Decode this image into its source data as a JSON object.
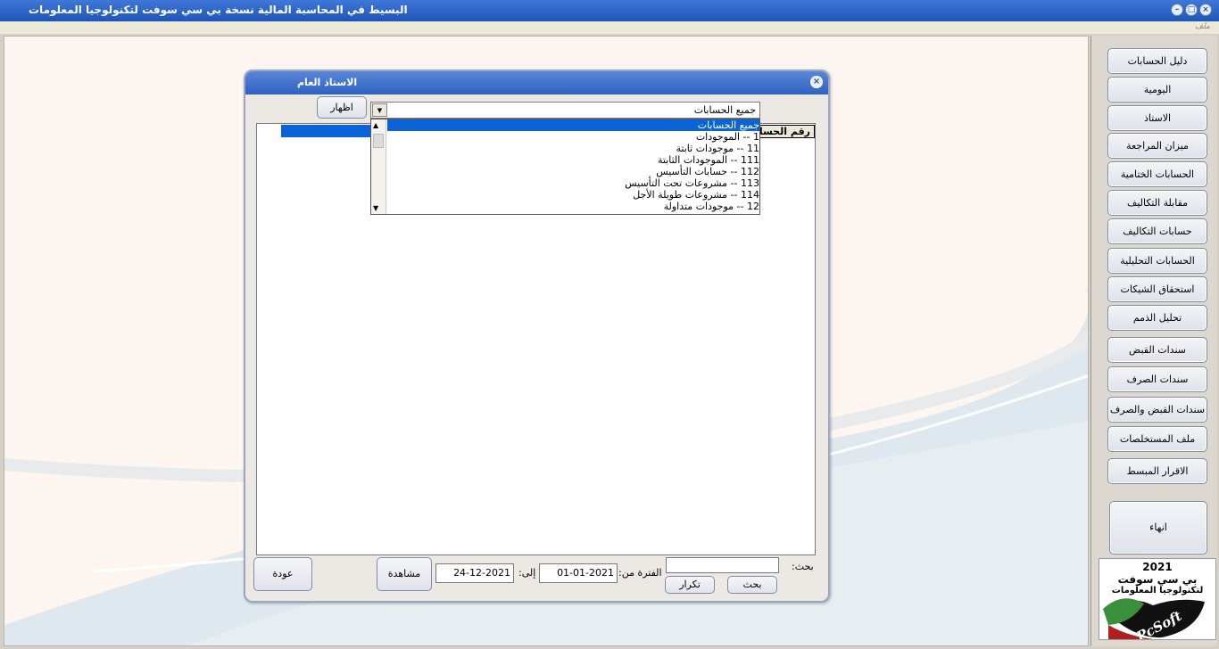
{
  "app": {
    "title": "البسيط في المحاسبة المالية   نسخة بي سي سوفت لتكنولوجيا المعلومات",
    "menu": "ملف",
    "window_buttons": [
      "minimize-icon",
      "restore-icon",
      "close-icon"
    ]
  },
  "sidebar": {
    "items": [
      {
        "label": "دليل الحسابات"
      },
      {
        "label": "اليومية"
      },
      {
        "label": "الاستاذ"
      },
      {
        "label": "ميزان المراجعة"
      },
      {
        "label": "الحسابات الختامية"
      },
      {
        "label": "مقابلة التكاليف"
      },
      {
        "label": "حسابات التكاليف"
      },
      {
        "label": "الحسابات التحليلية"
      },
      {
        "label": "استحقاق الشيكات"
      },
      {
        "label": "تحليل الذمم"
      },
      {
        "label": "سندات القبض"
      },
      {
        "label": "سندات الصرف"
      },
      {
        "label": "سندات القبض والصرف"
      },
      {
        "label": "ملف المستخلصات"
      },
      {
        "label": "الاقرار المبسط"
      }
    ],
    "exit_label": "انهاء"
  },
  "logo": {
    "year": "2021",
    "line1": "بي سي سوفت",
    "line2": "لتكنولوجيا المعلومات",
    "brand": "PcSoft"
  },
  "dialog": {
    "title": "الاستاذ العام",
    "show_button": "اظهار",
    "account_combo": {
      "value": "جميع الحسابات",
      "options": [
        "جميع الحسابات",
        "1 -- الموجودات",
        "11 -- موجودات ثابتة",
        "111 -- الموجودات الثابتة",
        "112 -- حسابات التأسيس",
        "113 -- مشروعات تحت التأسيس",
        "114 -- مشروعات طويلة الأجل",
        "12 -- موجودات متداولة"
      ],
      "selected_index": 0
    },
    "grid_header": "رقم الحساب",
    "search_label": "بحث:",
    "search_value": "",
    "search_button": "بحث",
    "repeat_button": "تكرار",
    "period_from_label": "الفترة من:",
    "period_from": "01-01-2021",
    "period_to_label": "إلى:",
    "period_to": "24-12-2021",
    "view_button": "مشاهدة",
    "back_button": "عودة"
  },
  "colors": {
    "titlebar": "#2e62c0",
    "selection": "#0a64d8"
  }
}
